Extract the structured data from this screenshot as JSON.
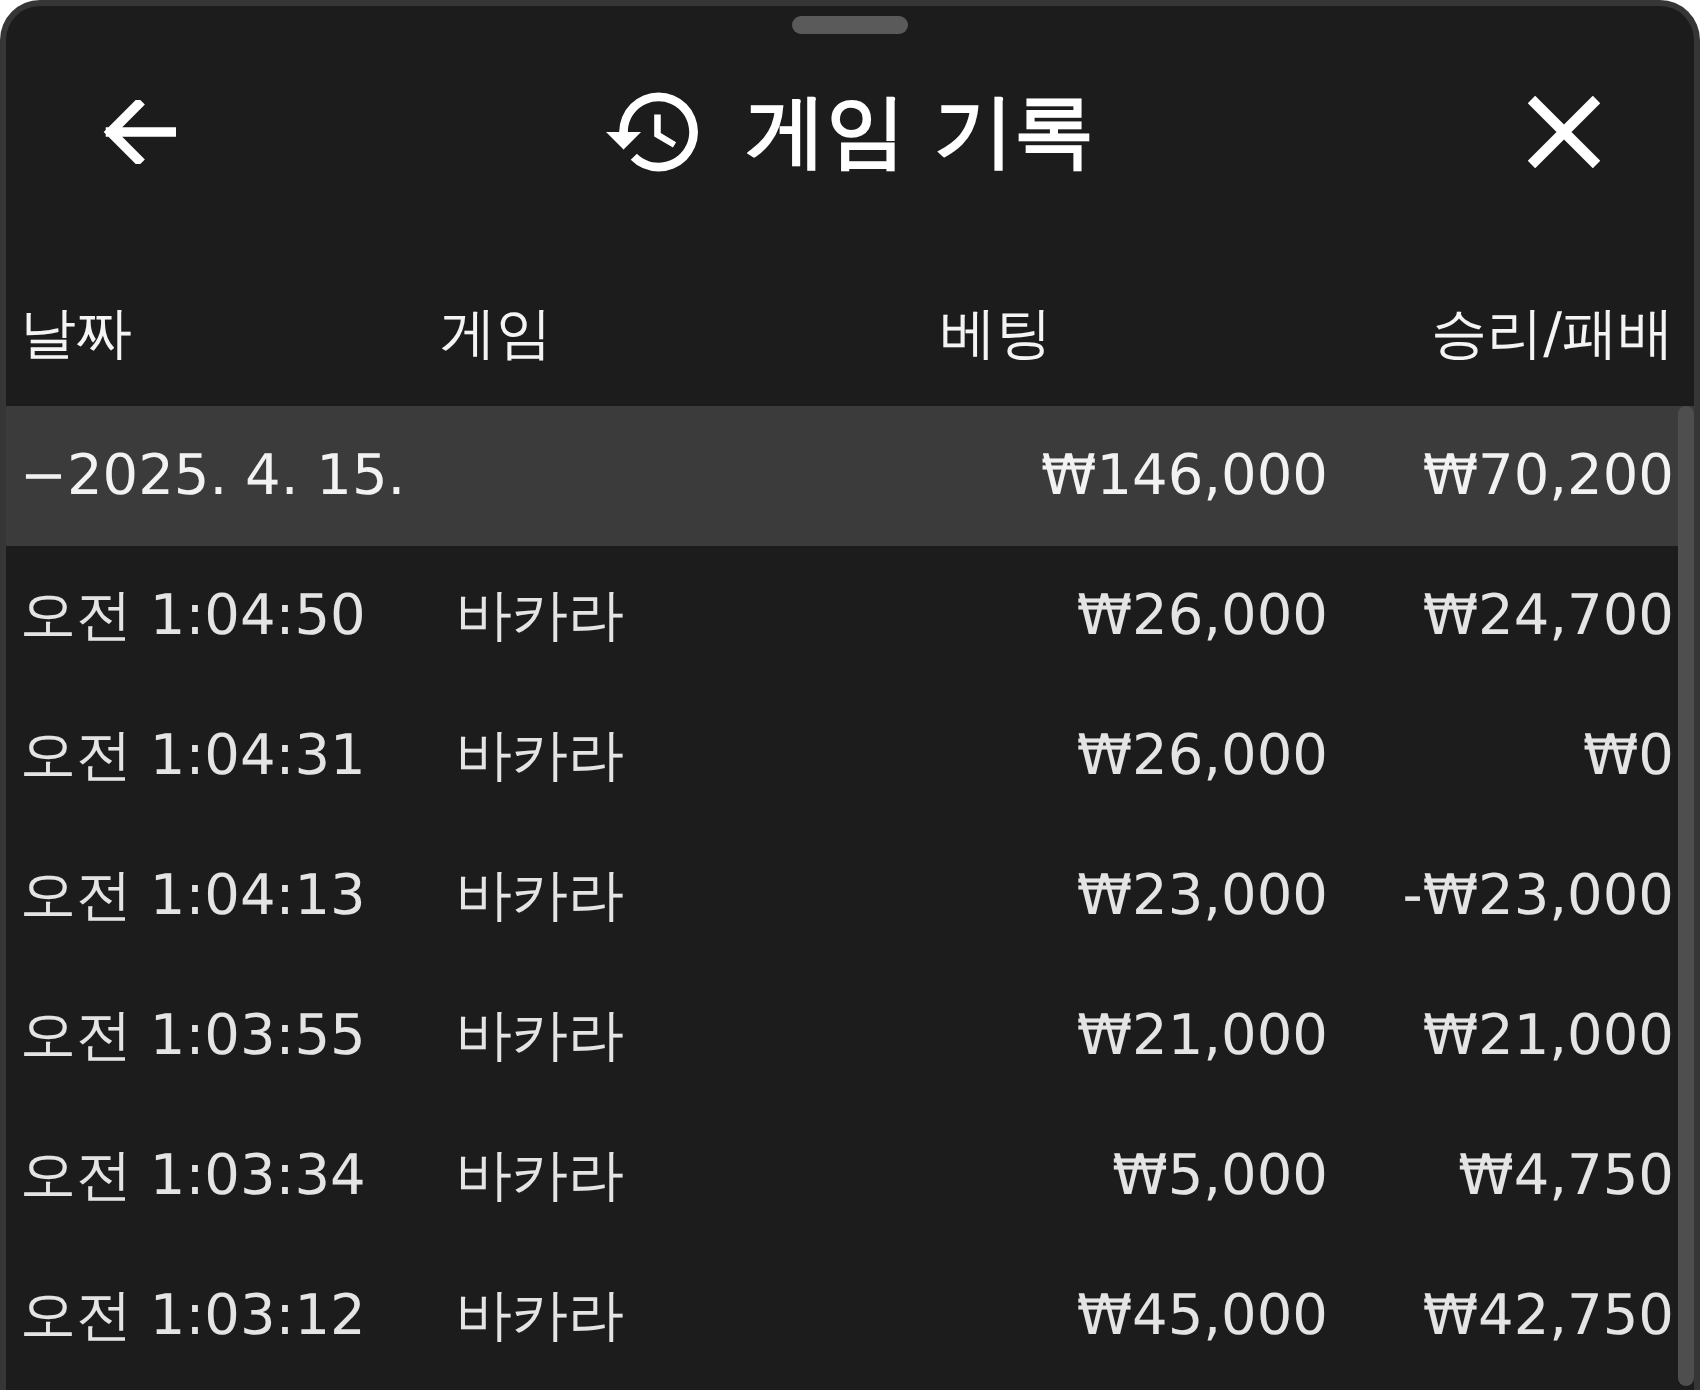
{
  "header": {
    "title": "게임 기록"
  },
  "table": {
    "columns": [
      "날짜",
      "게임",
      "베팅",
      "승리/패배"
    ],
    "rows": [
      {
        "kind": "group",
        "date": "−2025. 4. 15.",
        "bet": "₩146,000",
        "result": "₩70,200"
      },
      {
        "kind": "entry",
        "time": "오전 1:04:50",
        "game": "바카라",
        "bet": "₩26,000",
        "result": "₩24,700"
      },
      {
        "kind": "entry",
        "time": "오전 1:04:31",
        "game": "바카라",
        "bet": "₩26,000",
        "result": "₩0"
      },
      {
        "kind": "entry",
        "time": "오전 1:04:13",
        "game": "바카라",
        "bet": "₩23,000",
        "result": "-₩23,000"
      },
      {
        "kind": "entry",
        "time": "오전 1:03:55",
        "game": "바카라",
        "bet": "₩21,000",
        "result": "₩21,000"
      },
      {
        "kind": "entry",
        "time": "오전 1:03:34",
        "game": "바카라",
        "bet": "₩5,000",
        "result": "₩4,750"
      },
      {
        "kind": "entry",
        "time": "오전 1:03:12",
        "game": "바카라",
        "bet": "₩45,000",
        "result": "₩42,750"
      }
    ]
  }
}
